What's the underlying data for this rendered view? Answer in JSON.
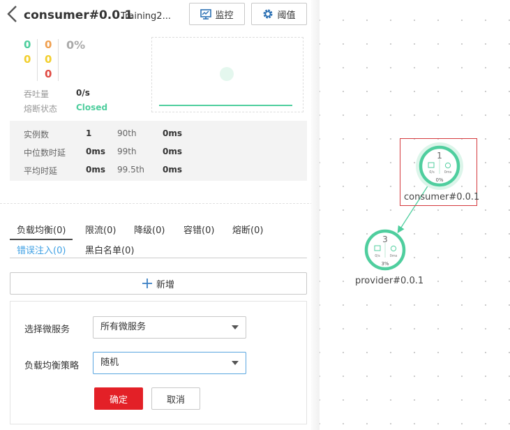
{
  "header": {
    "title": "consumer#0.0.1",
    "subtitle": "Training2...",
    "monitor_label": "监控",
    "threshold_label": "阈值"
  },
  "counters": {
    "col1": [
      "0",
      "0"
    ],
    "col2": [
      "0",
      "0",
      "0"
    ],
    "percent": "0%"
  },
  "metrics": {
    "throughput_label": "吞吐量",
    "throughput_value": "0/s",
    "breaker_label": "熔断状态",
    "breaker_value": "Closed"
  },
  "stats": {
    "rows": [
      {
        "k1": "实例数",
        "v1": "1",
        "k2": "90th",
        "v2": "0ms"
      },
      {
        "k1": "中位数时延",
        "v1": "0ms",
        "k2": "99th",
        "v2": "0ms"
      },
      {
        "k1": "平均时延",
        "v1": "0ms",
        "k2": "99.5th",
        "v2": "0ms"
      }
    ]
  },
  "tabs": {
    "row1": [
      "负载均衡(0)",
      "限流(0)",
      "降级(0)",
      "容错(0)",
      "熔断(0)"
    ],
    "row2": [
      "错误注入(0)",
      "黑白名单(0)"
    ]
  },
  "add_button": "新增",
  "form": {
    "service_label": "选择微服务",
    "service_value": "所有微服务",
    "strategy_label": "负载均衡策略",
    "strategy_value": "随机",
    "confirm": "确定",
    "cancel": "取消"
  },
  "topology": {
    "nodes": [
      {
        "name": "consumer#0.0.1",
        "instances": "1",
        "throughput": "0/s",
        "latency": "0ms",
        "error_rate": "0%"
      },
      {
        "name": "provider#0.0.1",
        "instances": "3",
        "throughput": "0/s",
        "latency": "0ms",
        "error_rate": "3%"
      }
    ]
  },
  "colors": {
    "green": "#4fce9e",
    "orange": "#f0a050",
    "red": "#e04b43",
    "yellow": "#f2cf2e",
    "blue": "#3ea0e4",
    "danger": "#e32027"
  }
}
